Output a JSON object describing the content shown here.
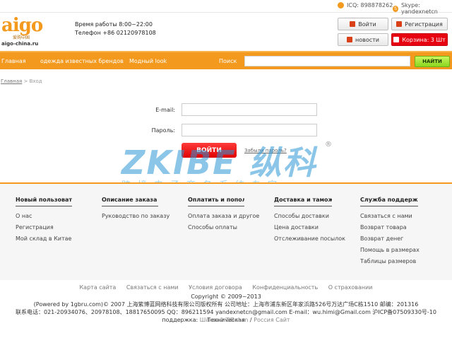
{
  "topbar": {
    "icq": "ICQ: 898878262",
    "skype": "Skype: yandexnetcn"
  },
  "logo": {
    "main": "aigo",
    "cn": "爱购中国",
    "url": "aigo-china.ru"
  },
  "header": {
    "hours": "Время работы 8:00~22:00",
    "phone": "Телефон +86 02120978108",
    "login_label": "Войти",
    "register_label": "Регистрация",
    "news_label": "новости",
    "cart_label": "Корзина: 3 Шт"
  },
  "nav": {
    "items": [
      "Главная",
      "одежда известных брендов",
      "Модный look"
    ],
    "search_label": "Поиск",
    "search_value": "",
    "search_button": "НАЙТИ"
  },
  "breadcrumb": {
    "home": "Главная",
    "sep": " > ",
    "current": "Вход"
  },
  "login_form": {
    "email_label": "E-mail:",
    "email_value": "",
    "password_label": "Пароль:",
    "password_value": "",
    "submit_label": "ВОЙТИ",
    "forgot_label": "Забыли пароль?"
  },
  "watermark": {
    "main": "ZKIBE 纵科",
    "sub": "跨境电子商务系统专家",
    "reg": "®"
  },
  "footer": {
    "columns": [
      {
        "title": "Новый пользователь",
        "links": [
          "О нас",
          "Регистрация",
          "Мой склад в Китае"
        ]
      },
      {
        "title": "Описание заказа",
        "links": [
          "Руководство по заказу"
        ]
      },
      {
        "title": "Оплатить и пополнить",
        "links": [
          "Оплата заказа и другое",
          "Способы оплаты"
        ]
      },
      {
        "title": "Доставка и таможня",
        "links": [
          "Способы доставки",
          "Цена доставки",
          "Отслеживание посылок"
        ]
      },
      {
        "title": "Служба поддержки",
        "links": [
          "Связаться с нами",
          "Возврат товара",
          "Возврат денег",
          "Помощь в размерах",
          "Таблицы размеров"
        ]
      }
    ],
    "bottom_links": [
      "Карта сайта",
      "Связаться с нами",
      "Условия договора",
      "Конфиденциальность",
      "О страховании"
    ],
    "copyright": "Copyright © 2009~2013",
    "powered": "(Powered by 1gbru.com)© 2007 上海紫博蓝网络科技有限公司版权所有    公司地址：上海市浦东新区年家浜路526号万达广场C栋1510    邮编：201316",
    "contacts": "联系电话：021-20934076、20978108、18817650095    QQ：896211594    yandexnetcn@gmail.com  E-mail：wu.himi@Gmail.com   沪ICP备07509330号-10 Техническая",
    "support_prefix": "поддержка:",
    "support_company": "Шанхай ZiBoLan",
    "support_sep": " / ",
    "support_site": "Россия Сайт"
  }
}
